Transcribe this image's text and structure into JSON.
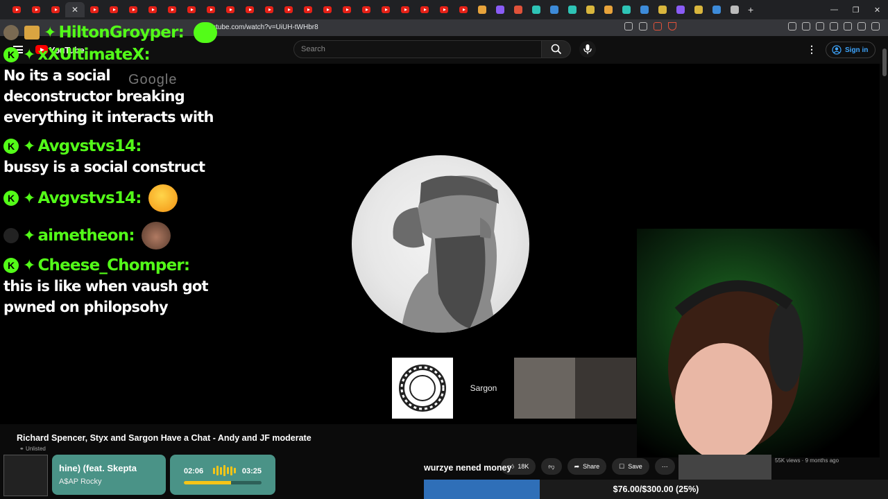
{
  "browser": {
    "url": "youtube.com/watch?v=UiUH-tWHbr8",
    "tab_count": 24
  },
  "youtube": {
    "logo_text": "YouTube",
    "search_placeholder": "Search",
    "signin_label": "Sign in"
  },
  "video": {
    "watermark": "Google",
    "participant_name": "Sargon",
    "title": "Richard Spencer, Styx and Sargon Have a Chat - Andy and JF moderate",
    "unlisted": "Unlisted",
    "likes": "18K",
    "share_label": "Share",
    "save_label": "Save",
    "related_meta": "55K views · 9 months ago"
  },
  "chat": {
    "header_user": "HiltonGroyper:",
    "messages": [
      {
        "user": "xXUltimateX:",
        "text": "No its a social deconstructor breaking everything it interacts with"
      },
      {
        "user": "Avgvstvs14:",
        "text": "bussy is a social construct"
      },
      {
        "user": "Avgvstvs14:",
        "text": ""
      },
      {
        "user": "aimetheon:",
        "text": ""
      },
      {
        "user": "Cheese_Chomper:",
        "text": "this is like when vaush got pwned on philopsohy"
      }
    ],
    "accent_color": "#53fc18"
  },
  "music": {
    "song": "hine) (feat. Skepta",
    "artist": "A$AP Rocky",
    "current_time": "02:06",
    "total_time": "03:25",
    "progress_fraction": 0.61
  },
  "ticker": {
    "text": "wurzye nened money"
  },
  "donation": {
    "text": "$76.00/$300.00 (25%)",
    "fraction": 0.25
  }
}
